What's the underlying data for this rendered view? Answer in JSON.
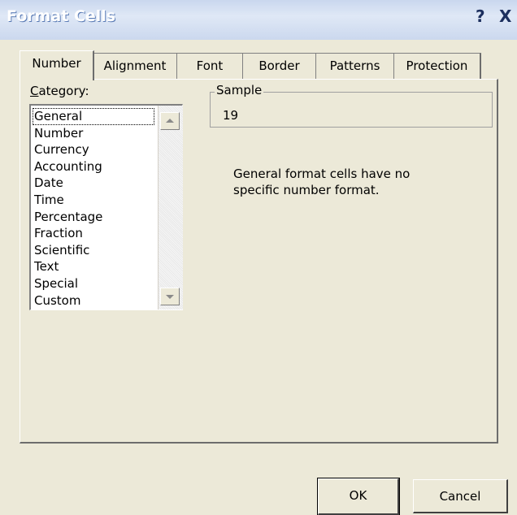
{
  "window": {
    "title": "Format Cells",
    "help_label": "?",
    "close_label": "X"
  },
  "tabs": [
    {
      "label": "Number",
      "active": true
    },
    {
      "label": "Alignment",
      "active": false
    },
    {
      "label": "Font",
      "active": false
    },
    {
      "label": "Border",
      "active": false
    },
    {
      "label": "Patterns",
      "active": false
    },
    {
      "label": "Protection",
      "active": false
    }
  ],
  "category": {
    "label_accel": "C",
    "label_rest": "ategory:",
    "items": [
      "General",
      "Number",
      "Currency",
      "Accounting",
      "Date",
      "Time",
      "Percentage",
      "Fraction",
      "Scientific",
      "Text",
      "Special",
      "Custom"
    ],
    "selected": "General"
  },
  "sample": {
    "legend": "Sample",
    "value": "19"
  },
  "description": {
    "line1": "General format cells have no",
    "line2": "specific number format."
  },
  "buttons": {
    "ok": "OK",
    "cancel": "Cancel"
  },
  "icons": [
    "help-icon",
    "close-icon",
    "scroll-up-arrow-icon",
    "scroll-down-arrow-icon"
  ]
}
